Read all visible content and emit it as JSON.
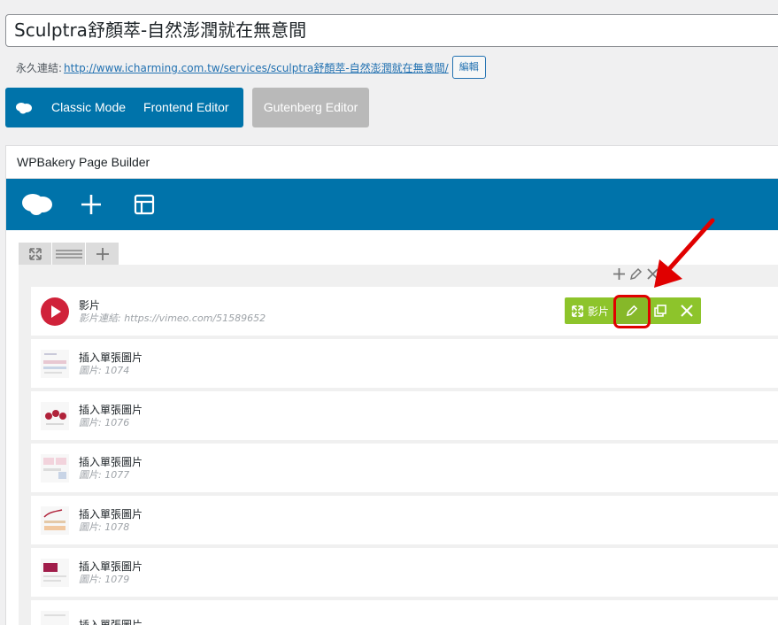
{
  "post": {
    "title": "Sculptra舒顏萃-自然澎潤就在無意間",
    "permalink_label": "永久連結:",
    "permalink_url": "http://www.icharming.com.tw/services/sculptra舒顏萃-自然澎潤就在無意間/",
    "edit_button": "編輯"
  },
  "mode_switch": {
    "classic": "Classic Mode",
    "frontend": "Frontend Editor",
    "gutenberg": "Gutenberg Editor"
  },
  "builder": {
    "title": "WPBakery Page Builder"
  },
  "elements": [
    {
      "title": "影片",
      "sub": "影片連結: https://vimeo.com/51589652",
      "icon": "play-icon"
    },
    {
      "title": "插入單張圖片",
      "sub": "圖片: 1074",
      "icon": "image-thumbnail"
    },
    {
      "title": "插入單張圖片",
      "sub": "圖片: 1076",
      "icon": "image-thumbnail"
    },
    {
      "title": "插入單張圖片",
      "sub": "圖片: 1077",
      "icon": "image-thumbnail"
    },
    {
      "title": "插入單張圖片",
      "sub": "圖片: 1078",
      "icon": "image-thumbnail"
    },
    {
      "title": "插入單張圖片",
      "sub": "圖片: 1079",
      "icon": "image-thumbnail"
    },
    {
      "title": "插入單張圖片",
      "sub": "",
      "icon": "image-thumbnail"
    }
  ],
  "element_actions": {
    "move_label": "影片"
  },
  "colors": {
    "wp_blue": "#0073aa",
    "action_green": "#8dc42b",
    "highlight_red": "#e00000",
    "play_red": "#d0223a"
  }
}
